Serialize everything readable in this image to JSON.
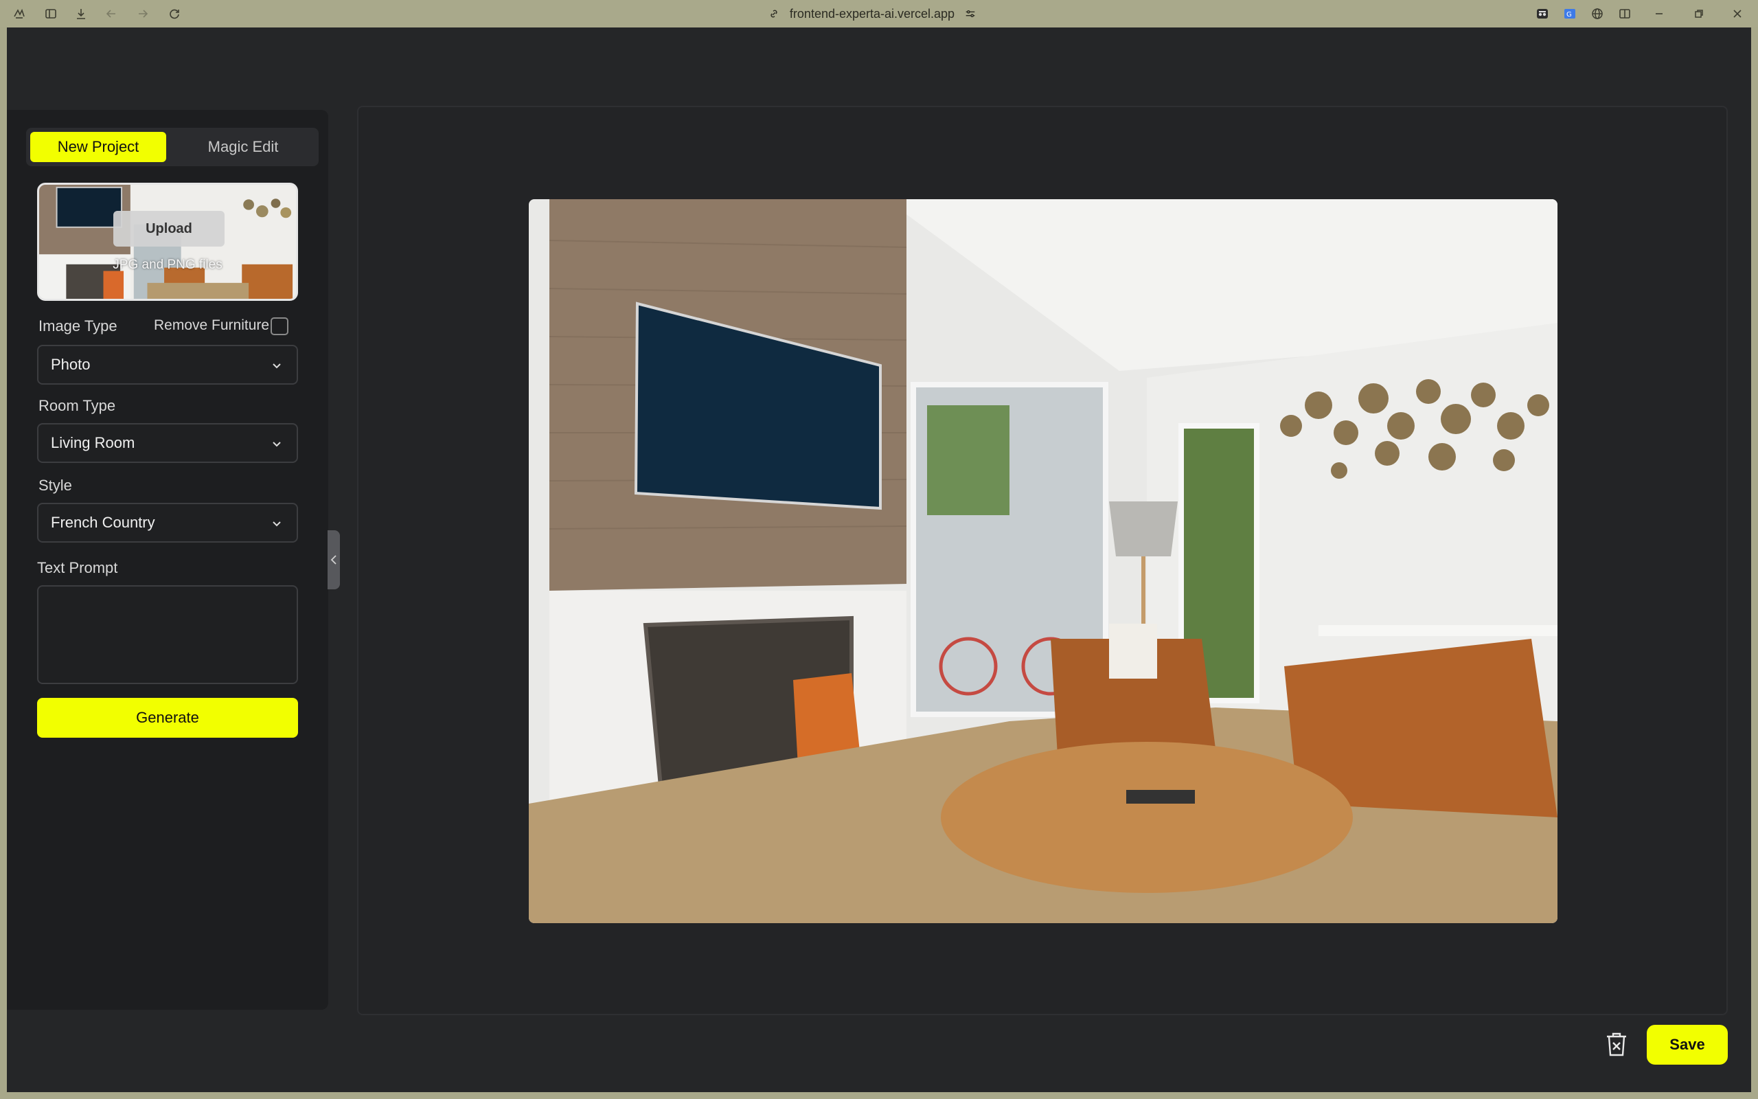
{
  "browser": {
    "url": "frontend-experta-ai.vercel.app",
    "icons": [
      "app-logo-icon",
      "sidebar-toggle-icon",
      "download-icon",
      "back-icon",
      "forward-icon",
      "reload-icon",
      "link-icon",
      "site-settings-icon",
      "incognito-icon",
      "translate-icon",
      "globe-icon",
      "split-view-icon",
      "minimize-icon",
      "maximize-icon",
      "close-icon"
    ]
  },
  "sidebar": {
    "tabs": [
      {
        "label": "New Project",
        "active": true
      },
      {
        "label": "Magic Edit",
        "active": false
      }
    ],
    "upload": {
      "button_label": "Upload",
      "hint": "JPG and PNG files"
    },
    "image_type": {
      "label": "Image Type",
      "value": "Photo"
    },
    "remove_furniture": {
      "label": "Remove Furniture",
      "checked": false
    },
    "room_type": {
      "label": "Room Type",
      "value": "Living Room"
    },
    "style": {
      "label": "Style",
      "value": "French Country"
    },
    "text_prompt": {
      "label": "Text Prompt",
      "value": ""
    },
    "generate_label": "Generate"
  },
  "footer": {
    "save_label": "Save"
  },
  "colors": {
    "accent": "#f2ff00",
    "background": "#252628",
    "sidebar": "#1d1e20"
  }
}
